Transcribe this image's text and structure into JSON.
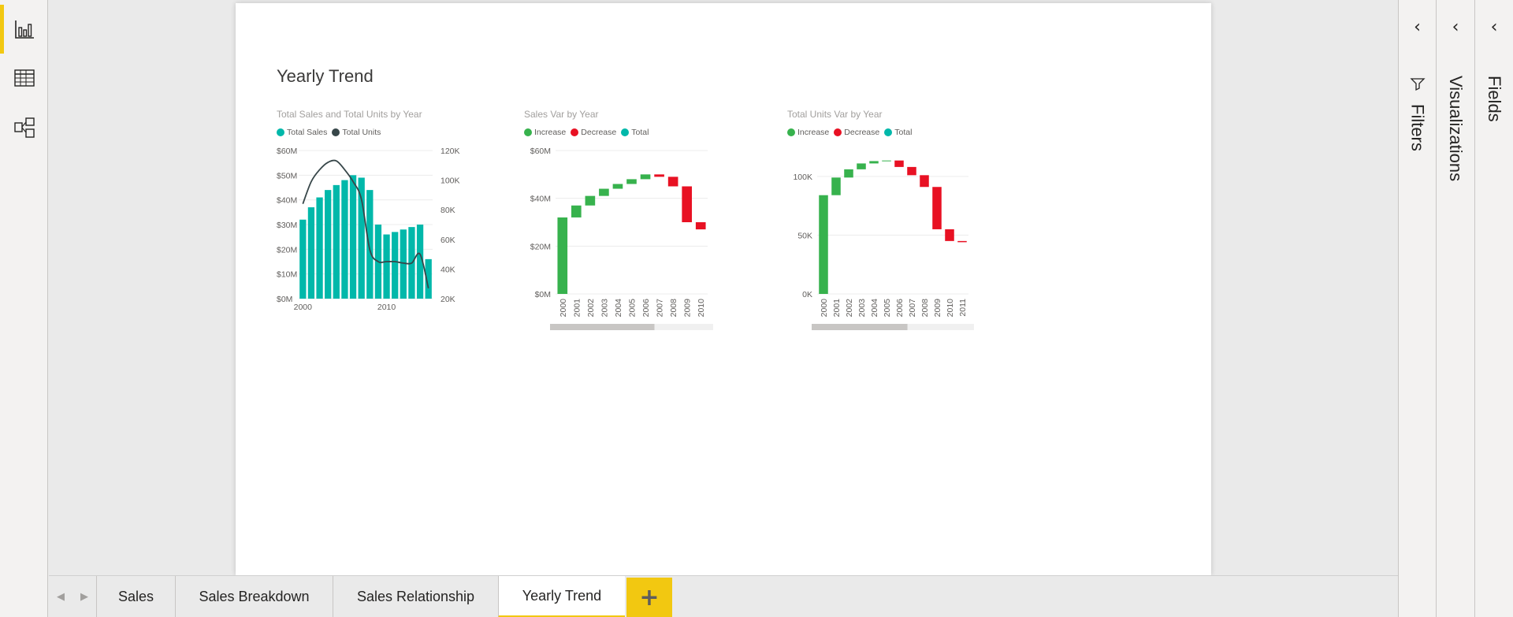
{
  "nav": {
    "items": [
      {
        "name": "report-view",
        "icon": "bar-chart-icon",
        "active": true
      },
      {
        "name": "data-view",
        "icon": "table-grid-icon",
        "active": false
      },
      {
        "name": "model-view",
        "icon": "model-relationship-icon",
        "active": false
      }
    ],
    "accent_color": "#f2c811"
  },
  "page": {
    "title": "Yearly Trend"
  },
  "visuals": {
    "combo": {
      "title": "Total Sales and Total Units by Year",
      "legend": [
        {
          "label": "Total Sales",
          "color": "#01b8aa"
        },
        {
          "label": "Total Units",
          "color": "#374649"
        }
      ]
    },
    "sales_var": {
      "title": "Sales Var by Year",
      "legend": [
        {
          "label": "Increase",
          "color": "#37b24d"
        },
        {
          "label": "Decrease",
          "color": "#e81123"
        },
        {
          "label": "Total",
          "color": "#01b8aa"
        }
      ]
    },
    "units_var": {
      "title": "Total Units Var by Year",
      "legend": [
        {
          "label": "Increase",
          "color": "#37b24d"
        },
        {
          "label": "Decrease",
          "color": "#e81123"
        },
        {
          "label": "Total",
          "color": "#01b8aa"
        }
      ]
    }
  },
  "chart_data": [
    {
      "type": "bar",
      "title": "Total Sales and Total Units by Year",
      "x": [
        2000,
        2001,
        2002,
        2003,
        2004,
        2005,
        2006,
        2007,
        2008,
        2009,
        2010,
        2011,
        2012,
        2013,
        2014,
        2015
      ],
      "x_tick_labels": [
        "2000",
        "2010"
      ],
      "series": [
        {
          "name": "Total Sales",
          "type": "bar",
          "axis": "left",
          "color": "#01b8aa",
          "values": [
            32,
            37,
            41,
            44,
            46,
            48,
            50,
            49,
            44,
            30,
            26,
            27,
            28,
            29,
            30,
            16
          ]
        },
        {
          "name": "Total Units",
          "type": "line",
          "axis": "right",
          "color": "#374649",
          "values": [
            84,
            99,
            107,
            112,
            113,
            107,
            99,
            87,
            53,
            45,
            45,
            45,
            44,
            44,
            50,
            27
          ]
        }
      ],
      "y_left": {
        "ticks": [
          0,
          10,
          20,
          30,
          40,
          50,
          60
        ],
        "labels": [
          "$0M",
          "$10M",
          "$20M",
          "$30M",
          "$40M",
          "$50M",
          "$60M"
        ],
        "range": [
          0,
          60
        ]
      },
      "y_right": {
        "ticks": [
          20,
          40,
          60,
          80,
          100,
          120
        ],
        "labels": [
          "20K",
          "40K",
          "60K",
          "80K",
          "100K",
          "120K"
        ],
        "range": [
          20,
          120
        ]
      }
    },
    {
      "type": "bar",
      "subtype": "waterfall",
      "title": "Sales Var by Year",
      "categories": [
        "2000",
        "2001",
        "2002",
        "2003",
        "2004",
        "2005",
        "2006",
        "2007",
        "2008",
        "2009",
        "2010"
      ],
      "steps": [
        {
          "from": 0,
          "to": 32,
          "kind": "increase"
        },
        {
          "from": 32,
          "to": 37,
          "kind": "increase"
        },
        {
          "from": 37,
          "to": 41,
          "kind": "increase"
        },
        {
          "from": 41,
          "to": 44,
          "kind": "increase"
        },
        {
          "from": 44,
          "to": 46,
          "kind": "increase"
        },
        {
          "from": 46,
          "to": 48,
          "kind": "increase"
        },
        {
          "from": 48,
          "to": 50,
          "kind": "increase"
        },
        {
          "from": 50,
          "to": 49,
          "kind": "decrease"
        },
        {
          "from": 49,
          "to": 45,
          "kind": "decrease"
        },
        {
          "from": 45,
          "to": 30,
          "kind": "decrease"
        },
        {
          "from": 30,
          "to": 27,
          "kind": "decrease"
        }
      ],
      "y": {
        "ticks": [
          0,
          20,
          40,
          60
        ],
        "labels": [
          "$0M",
          "$20M",
          "$40M",
          "$60M"
        ],
        "range": [
          0,
          60
        ]
      }
    },
    {
      "type": "bar",
      "subtype": "waterfall",
      "title": "Total Units Var by Year",
      "categories": [
        "2000",
        "2001",
        "2002",
        "2003",
        "2004",
        "2005",
        "2006",
        "2007",
        "2008",
        "2009",
        "2010",
        "2011"
      ],
      "steps": [
        {
          "from": 0,
          "to": 84,
          "kind": "increase"
        },
        {
          "from": 84,
          "to": 99,
          "kind": "increase"
        },
        {
          "from": 99,
          "to": 106,
          "kind": "increase"
        },
        {
          "from": 106,
          "to": 111,
          "kind": "increase"
        },
        {
          "from": 111,
          "to": 113,
          "kind": "increase"
        },
        {
          "from": 113,
          "to": 113.5,
          "kind": "increase"
        },
        {
          "from": 113.5,
          "to": 108,
          "kind": "decrease"
        },
        {
          "from": 108,
          "to": 101,
          "kind": "decrease"
        },
        {
          "from": 101,
          "to": 91,
          "kind": "decrease"
        },
        {
          "from": 91,
          "to": 55,
          "kind": "decrease"
        },
        {
          "from": 55,
          "to": 45,
          "kind": "decrease"
        },
        {
          "from": 45,
          "to": 44,
          "kind": "decrease"
        }
      ],
      "y": {
        "ticks": [
          0,
          50,
          100
        ],
        "labels": [
          "0K",
          "50K",
          "100K"
        ],
        "range": [
          0,
          122
        ]
      }
    }
  ],
  "tabs": {
    "items": [
      "Sales",
      "Sales Breakdown",
      "Sales Relationship",
      "Yearly Trend"
    ],
    "active": "Yearly Trend",
    "add_label": "+"
  },
  "panes": {
    "filters": {
      "label": "Filters",
      "chevron": "‹"
    },
    "visualizations": {
      "label": "Visualizations",
      "chevron": "‹"
    },
    "fields": {
      "label": "Fields",
      "chevron": "‹"
    }
  }
}
